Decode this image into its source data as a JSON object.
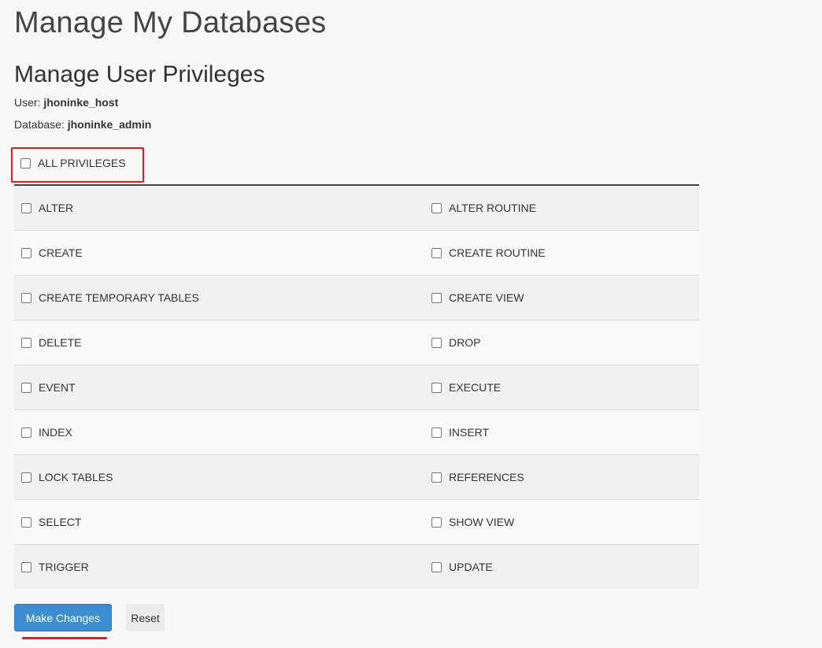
{
  "page": {
    "title": "Manage My Databases"
  },
  "section": {
    "title": "Manage User Privileges",
    "user_label": "User:",
    "user_value": "jhoninke_host",
    "database_label": "Database:",
    "database_value": "jhoninke_admin"
  },
  "all_privileges": {
    "label": "ALL PRIVILEGES",
    "checked": false
  },
  "privileges": [
    {
      "left": "ALTER",
      "right": "ALTER ROUTINE"
    },
    {
      "left": "CREATE",
      "right": "CREATE ROUTINE"
    },
    {
      "left": "CREATE TEMPORARY TABLES",
      "right": "CREATE VIEW"
    },
    {
      "left": "DELETE",
      "right": "DROP"
    },
    {
      "left": "EVENT",
      "right": "EXECUTE"
    },
    {
      "left": "INDEX",
      "right": "INSERT"
    },
    {
      "left": "LOCK TABLES",
      "right": "REFERENCES"
    },
    {
      "left": "SELECT",
      "right": "SHOW VIEW"
    },
    {
      "left": "TRIGGER",
      "right": "UPDATE"
    }
  ],
  "actions": {
    "submit_label": "Make Changes",
    "reset_label": "Reset"
  },
  "colors": {
    "primary": "#3c8dd1",
    "highlight": "#e31b23",
    "background": "#f8f8f8"
  }
}
